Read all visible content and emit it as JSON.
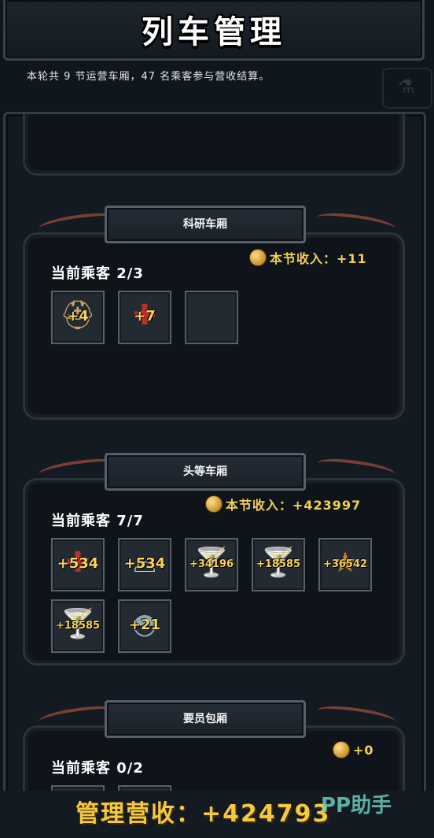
{
  "header": {
    "title": "列车管理",
    "summary": "本轮共 9 节运营车厢，47 名乘客参与营收结算。"
  },
  "wagons": [
    {
      "name": "科研车厢",
      "income": "本节收入：+11",
      "passengers": "当前乘客 2/3",
      "slots": [
        {
          "icon": "hard-hat-icon",
          "value": "+4"
        },
        {
          "icon": "medical-cross-icon",
          "value": "+7"
        },
        {
          "icon": "empty-slot",
          "value": ""
        }
      ]
    },
    {
      "name": "头等车厢",
      "income": "本节收入：+423997",
      "passengers": "当前乘客 7/7",
      "slots": [
        {
          "icon": "medical-cross-icon",
          "value": "+534"
        },
        {
          "icon": "nurse-cap-icon",
          "value": "+534"
        },
        {
          "icon": "goblet-icon",
          "value": "+34196"
        },
        {
          "icon": "goblet-icon",
          "value": "+18585"
        },
        {
          "icon": "star-badge-icon",
          "value": "+36542"
        },
        {
          "icon": "goblet-icon",
          "value": "+18585"
        },
        {
          "icon": "police-cap-icon",
          "value": "+21"
        }
      ]
    },
    {
      "name": "要员包厢",
      "income": "+0",
      "passengers": "当前乘客 0/2",
      "slots": []
    }
  ],
  "footer": {
    "total": "管理营收：+424793",
    "watermark": "PP助手"
  },
  "colors": {
    "gold": "#f5cf55",
    "background": "#10161d",
    "frame": "#56616c"
  }
}
